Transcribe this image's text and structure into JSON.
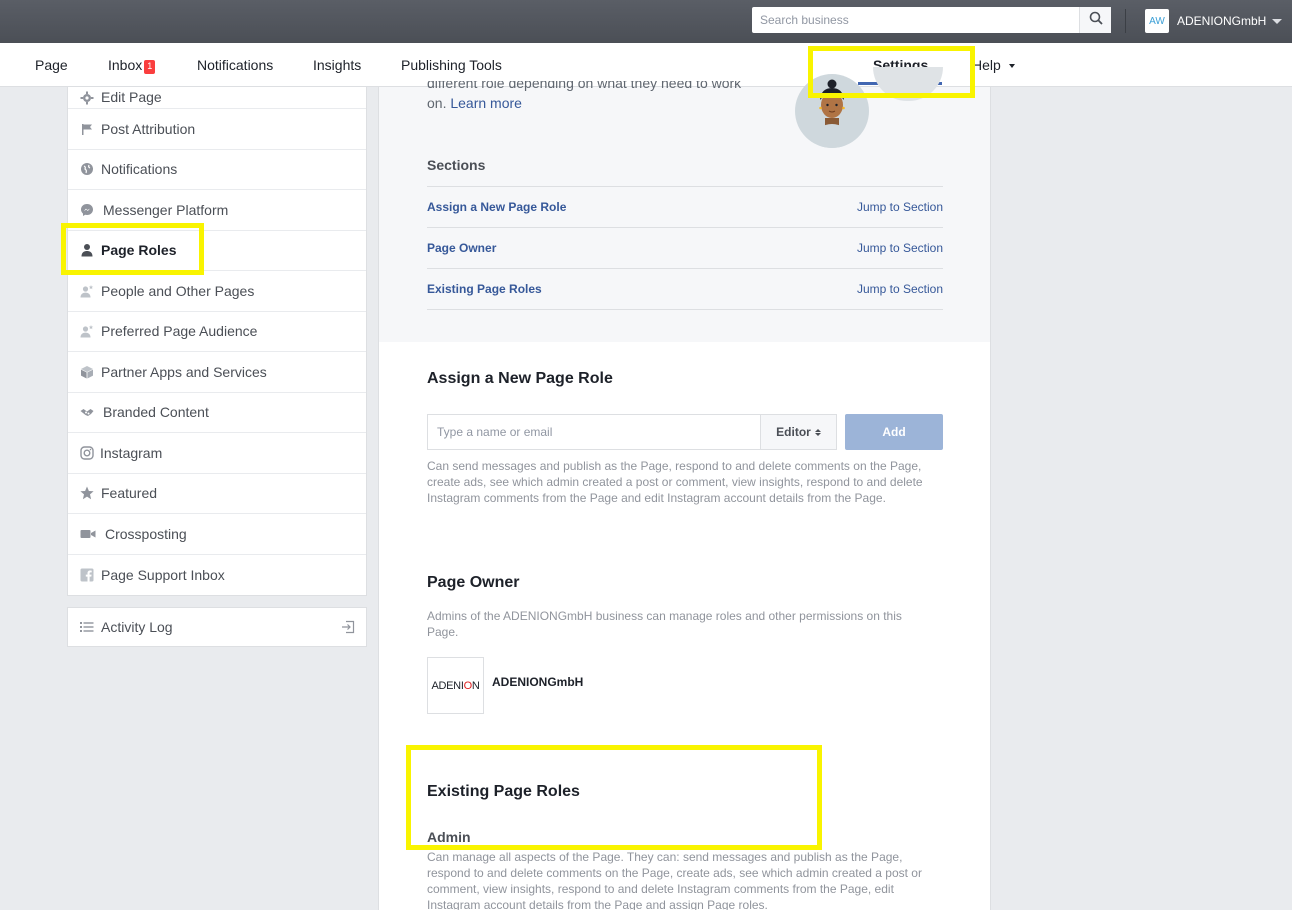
{
  "topbar": {
    "search_placeholder": "Search business",
    "account_badge": "AW",
    "account_name": "ADENIONGmbH"
  },
  "pagenav": {
    "page": "Page",
    "inbox": "Inbox",
    "inbox_badge": "1",
    "notifications": "Notifications",
    "insights": "Insights",
    "publishing_tools": "Publishing Tools",
    "settings": "Settings",
    "help": "Help"
  },
  "sidebar": {
    "items": [
      {
        "label": "Edit Page",
        "icon": "gear-icon"
      },
      {
        "label": "Post Attribution",
        "icon": "flag-icon"
      },
      {
        "label": "Notifications",
        "icon": "globe-icon"
      },
      {
        "label": "Messenger Platform",
        "icon": "messenger-icon"
      },
      {
        "label": "Page Roles",
        "icon": "person-icon"
      },
      {
        "label": "People and Other Pages",
        "icon": "person-star-icon"
      },
      {
        "label": "Preferred Page Audience",
        "icon": "person-star-icon"
      },
      {
        "label": "Partner Apps and Services",
        "icon": "cube-icon"
      },
      {
        "label": "Branded Content",
        "icon": "handshake-icon"
      },
      {
        "label": "Instagram",
        "icon": "instagram-icon"
      },
      {
        "label": "Featured",
        "icon": "star-icon"
      },
      {
        "label": "Crossposting",
        "icon": "video-icon"
      },
      {
        "label": "Page Support Inbox",
        "icon": "facebook-icon"
      }
    ],
    "activity_log": "Activity Log"
  },
  "intro": {
    "text_cut": "different role depending on what they need to work",
    "text_line": "on.",
    "learn_more": "Learn more"
  },
  "sections": {
    "title": "Sections",
    "rows": [
      {
        "name": "Assign a New Page Role",
        "jump": "Jump to Section"
      },
      {
        "name": "Page Owner",
        "jump": "Jump to Section"
      },
      {
        "name": "Existing Page Roles",
        "jump": "Jump to Section"
      }
    ]
  },
  "assign": {
    "title": "Assign a New Page Role",
    "placeholder": "Type a name or email",
    "role": "Editor",
    "add": "Add",
    "description": "Can send messages and publish as the Page, respond to and delete comments on the Page, create ads, see which admin created a post or comment, view insights, respond to and delete Instagram comments from the Page and edit Instagram account details from the Page."
  },
  "owner": {
    "title": "Page Owner",
    "description": "Admins of the ADENIONGmbH business can manage roles and other permissions on this Page.",
    "logo_text": "ADENI",
    "logo_o": "O",
    "logo_n": "N",
    "name": "ADENIONGmbH"
  },
  "existing": {
    "title": "Existing Page Roles",
    "admin_label": "Admin",
    "admin_description": "Can manage all aspects of the Page. They can: send messages and publish as the Page, respond to and delete comments on the Page, create ads, see which admin created a post or comment, view insights, respond to and delete Instagram comments from the Page, edit Instagram account details from the Page and assign Page roles."
  },
  "colors": {
    "highlight": "#f9f400",
    "link": "#365899",
    "active_tab": "#4267b2",
    "badge": "#fa3e3e"
  }
}
